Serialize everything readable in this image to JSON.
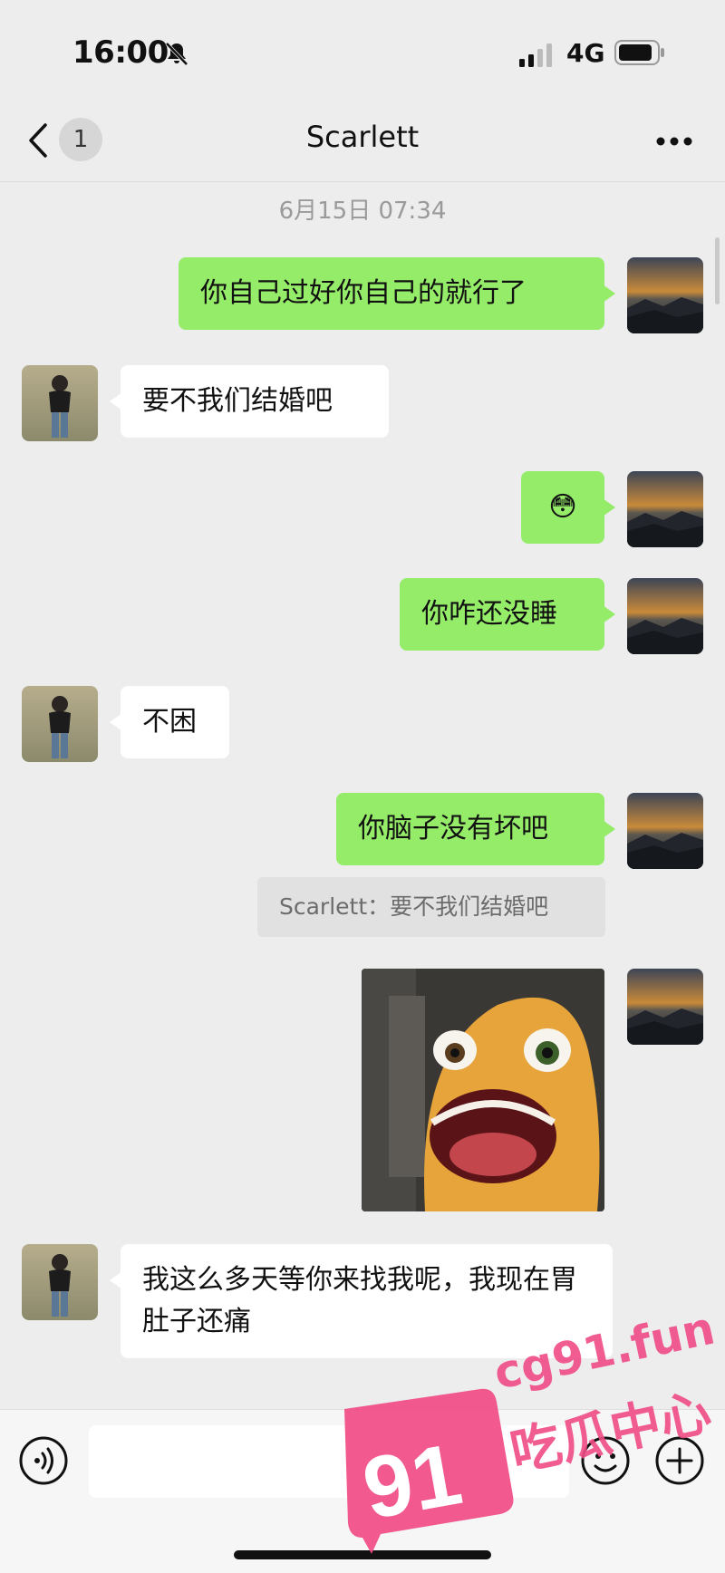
{
  "status_bar": {
    "time": "16:00",
    "network": "4G"
  },
  "nav": {
    "back_count": "1",
    "title": "Scarlett",
    "more_icon": "more-dots-icon"
  },
  "chat": {
    "timestamp": "6月15日 07:34",
    "messages": [
      {
        "from": "me",
        "text": "你自己过好你自己的就行了"
      },
      {
        "from": "her",
        "text": "要不我们结婚吧"
      },
      {
        "from": "me",
        "text": "😳"
      },
      {
        "from": "me",
        "text": "你咋还没睡"
      },
      {
        "from": "her",
        "text": "不困"
      },
      {
        "from": "me",
        "text": "你脑子没有坏吧"
      },
      {
        "from": "me",
        "type": "sticker",
        "text": ""
      },
      {
        "from": "her",
        "text": "我这么多天等你来找我呢，我现在胃肚子还痛"
      }
    ],
    "quote": "Scarlett：要不我们结婚吧"
  },
  "input_bar": {
    "value": "",
    "placeholder": ""
  },
  "watermark": {
    "site": "cg91.fun",
    "label": "吃瓜中心",
    "logo": "91"
  },
  "colors": {
    "my_bubble": "#95ec69",
    "her_bubble": "#ffffff",
    "background": "#ededed",
    "watermark": "#f04b86"
  }
}
